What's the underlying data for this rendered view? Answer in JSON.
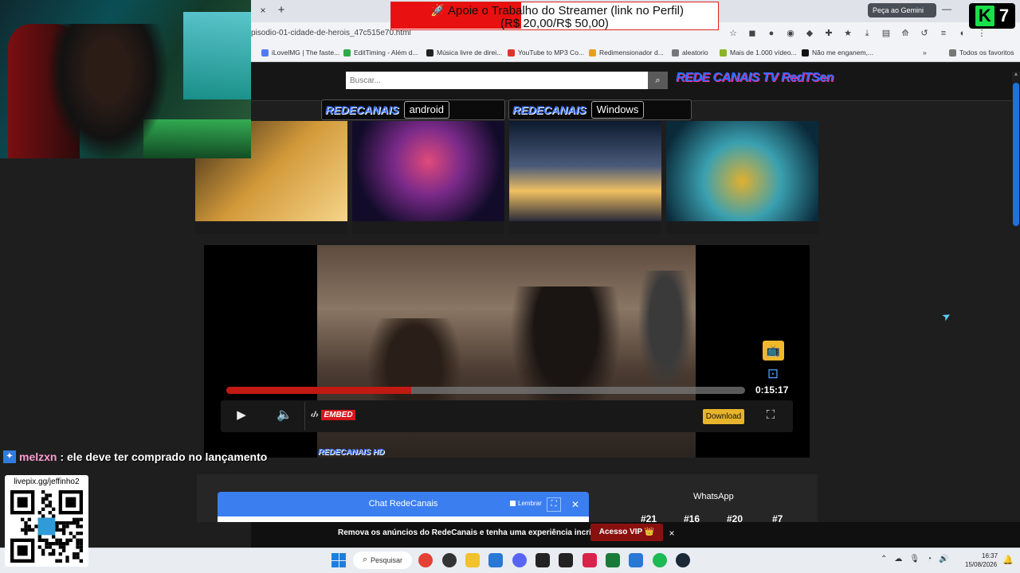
{
  "stream": {
    "donation_line1": "🚀 Apoie o Trabalho do Streamer (link no Perfil)",
    "donation_line2": "(R$ 20,00/R$ 50,00)",
    "chat_user": "melzxn",
    "chat_message": ": ele deve ter comprado no lançamento",
    "qr_label": "livepix.gg/jeffinho2",
    "channel_badge_letter": "K",
    "channel_badge_number": "7"
  },
  "browser": {
    "tab_close": "×",
    "tab_new": "+",
    "gemini_label": "Peça ao Gemini",
    "url": "pisodio-01-cidade-de-herois_47c515e70.html",
    "bookmarks": [
      {
        "label": "iLovelMG | The faste...",
        "color": "#4e7cf6"
      },
      {
        "label": "EditTiming - Além d...",
        "color": "#2eaa4a"
      },
      {
        "label": "Música livre de direi...",
        "color": "#222222"
      },
      {
        "label": "YouTube to MP3 Co...",
        "color": "#e2322a"
      },
      {
        "label": "Redimensionador d...",
        "color": "#e8a01a"
      },
      {
        "label": "aleatorio",
        "color": "#777777"
      },
      {
        "label": "Mais de 1.000 vídeo...",
        "color": "#8ab528"
      },
      {
        "label": "Não me enganem,...",
        "color": "#111111"
      },
      {
        "label": "Todos os favoritos",
        "color": "#777777"
      }
    ]
  },
  "site": {
    "search_placeholder": "Buscar...",
    "logo": "REDE CANAIS TV RedTSen",
    "badge_android_brand": "REDECANAIS",
    "badge_android_platform": "android",
    "badge_windows_brand": "REDECANAIS",
    "badge_windows_platform": "Windows",
    "thumbnails": [
      {
        "colors": [
          "#3a2a18",
          "#d39a3a",
          "#f5d48a"
        ]
      },
      {
        "colors": [
          "#120c2a",
          "#7a2a8a",
          "#e04a7a"
        ]
      },
      {
        "colors": [
          "#0c1a2e",
          "#4a5a7a",
          "#f0c060"
        ]
      },
      {
        "colors": [
          "#0a2a3a",
          "#3aa0b0",
          "#e0b030"
        ]
      }
    ]
  },
  "player": {
    "progress": 0.356,
    "timecode": "0:15:17",
    "embed_label": "EMBED",
    "download_label": "Download",
    "watermark": "REDECANAIS HD"
  },
  "chat": {
    "title": "Chat RedeCanais",
    "remember_label": "Lembrar"
  },
  "whatsapp": {
    "title": "WhatsApp",
    "ranks": [
      "#21",
      "#16",
      "#20",
      "#7"
    ]
  },
  "ad": {
    "text": "Remova os anúncios do RedeCanais e tenha uma experiência incrível!",
    "vip_label": "Acesso VIP 👑",
    "close": "×"
  },
  "taskbar": {
    "search_label": "Pesquisar",
    "time": "16:37",
    "date": "15/08/2026",
    "apps": [
      {
        "name": "chrome",
        "color": "#e34133"
      },
      {
        "name": "obs",
        "color": "#333333"
      },
      {
        "name": "explorer",
        "color": "#f2c12e"
      },
      {
        "name": "store",
        "color": "#2a78d6"
      },
      {
        "name": "discord",
        "color": "#5865f2"
      },
      {
        "name": "piano",
        "color": "#222222"
      },
      {
        "name": "audio",
        "color": "#222222"
      },
      {
        "name": "capcut",
        "color": "#d8234a"
      },
      {
        "name": "terminal",
        "color": "#1a7a3a"
      },
      {
        "name": "notes",
        "color": "#2a78d6"
      },
      {
        "name": "spotify",
        "color": "#1db954"
      },
      {
        "name": "steam",
        "color": "#1b2838"
      }
    ]
  }
}
